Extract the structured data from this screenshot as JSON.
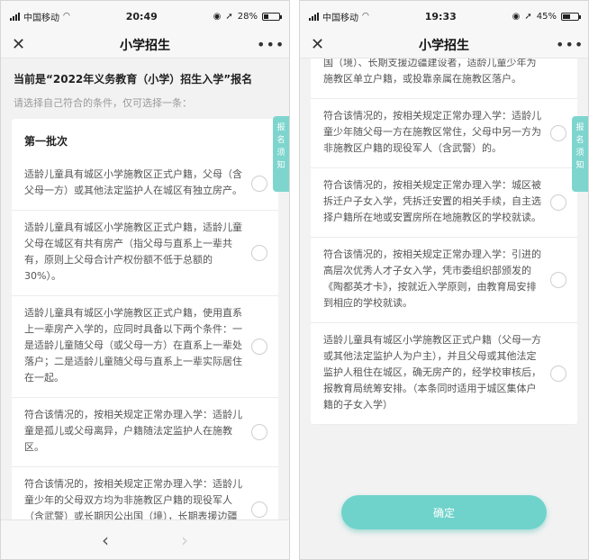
{
  "left": {
    "status": {
      "carrier": "中国移动",
      "time": "20:49",
      "battery": "28%",
      "battery_level": 0.28
    },
    "nav": {
      "close": "✕",
      "title": "小学招生",
      "more": "•••"
    },
    "header": "当前是“2022年义务教育（小学）招生入学”报名",
    "hint": "请选择自己符合的条件，仅可选择一条：",
    "batch_title": "第一批次",
    "side_tab": [
      "报",
      "名",
      "须",
      "知"
    ],
    "options": [
      "适龄儿童具有城区小学施教区正式户籍，父母（含父母一方）或其他法定监护人在城区有独立房产。",
      "适龄儿童具有城区小学施教区正式户籍，适龄儿童父母在城区有共有房产（指父母与直系上一辈共有，原则上父母合计产权份额不低于总额的30%）。",
      "适龄儿童具有城区小学施教区正式户籍，使用直系上一辈房产入学的，应同时具备以下两个条件：一是适龄儿童随父母（或父母一方）在直系上一辈处落户；二是适龄儿童随父母与直系上一辈实际居住在一起。",
      "符合该情况的，按相关规定正常办理入学：适龄儿童是孤儿或父母离异，户籍随法定监护人在施教区。",
      "符合该情况的，按相关规定正常办理入学：适龄儿童少年的父母双方均为非施教区户籍的现役军人（含武警）或长期因公出国（境），长期表援边疆建设者，适龄儿童"
    ],
    "bottom": {
      "back": "‹",
      "forward": "›"
    }
  },
  "right": {
    "status": {
      "carrier": "中国移动",
      "time": "19:33",
      "battery": "45%",
      "battery_level": 0.45
    },
    "nav": {
      "close": "✕",
      "title": "小学招生",
      "more": "•••"
    },
    "side_tab": [
      "报",
      "名",
      "须",
      "知"
    ],
    "options": [
      "国（境）、长期支援边疆建设者，适龄儿童少年为施教区单立户籍，或投靠亲属在施教区落户。",
      "符合该情况的，按相关规定正常办理入学：适龄儿童少年随父母一方在施教区常住，父母中另一方为非施教区户籍的现役军人（含武警）的。",
      "符合该情况的，按相关规定正常办理入学：城区被拆迁户子女入学，凭拆迁安置的相关手续，自主选择户籍所在地或安置房所在地施教区的学校就读。",
      "符合该情况的，按相关规定正常办理入学：引进的高层次优秀人才子女入学，凭市委组织部颁发的《陶都英才卡》，按就近入学原则，由教育局安排到相应的学校就读。",
      "适龄儿童具有城区小学施教区正式户籍（父母一方或其他法定监护人为户主），并且父母或其他法定监护人租住在城区，确无房产的，经学校审核后，报教育局统筹安排。（本条同时适用于城区集体户籍的子女入学）"
    ],
    "confirm": "确定"
  }
}
